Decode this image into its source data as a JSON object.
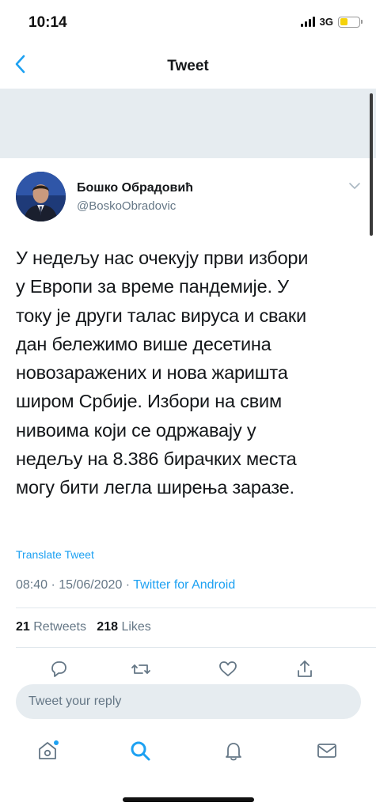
{
  "status_bar": {
    "time": "10:14",
    "network": "3G",
    "signal_bars": 4,
    "battery_fraction": 0.4,
    "battery_color": "#f5d20a"
  },
  "nav": {
    "back_icon": "chevron-left-icon",
    "title": "Tweet"
  },
  "author": {
    "name": "Бошко Обрадовић",
    "handle": "@BoskoObradovic"
  },
  "tweet": {
    "lines": [
      "У недељу нас очекују први избори",
      "у Европи за време пандемије. У",
      "току је други талас вируса и сваки",
      "дан бележимо више десетина",
      "новозаражених и нова жаришта",
      "широм Србије. Избори на свим",
      "нивоима који се одржавају у",
      "недељу на 8.386 бирачких места",
      "могу бити легла ширења заразе."
    ],
    "translate_label": "Translate Tweet",
    "datetime": "08:40 · 15/06/2020 · ",
    "source": "Twitter for Android"
  },
  "stats": {
    "retweets_count": "21",
    "retweets_label": "Retweets",
    "likes_count": "218",
    "likes_label": "Likes"
  },
  "actions": [
    "reply-icon",
    "retweet-icon",
    "like-icon",
    "share-icon"
  ],
  "reply": {
    "placeholder": "Tweet your reply"
  },
  "tabbar": [
    "home-icon",
    "search-icon",
    "notifications-icon",
    "messages-icon"
  ],
  "colors": {
    "accent": "#1da1f2",
    "secondary_text": "#657786",
    "band": "#e6ecf0"
  }
}
